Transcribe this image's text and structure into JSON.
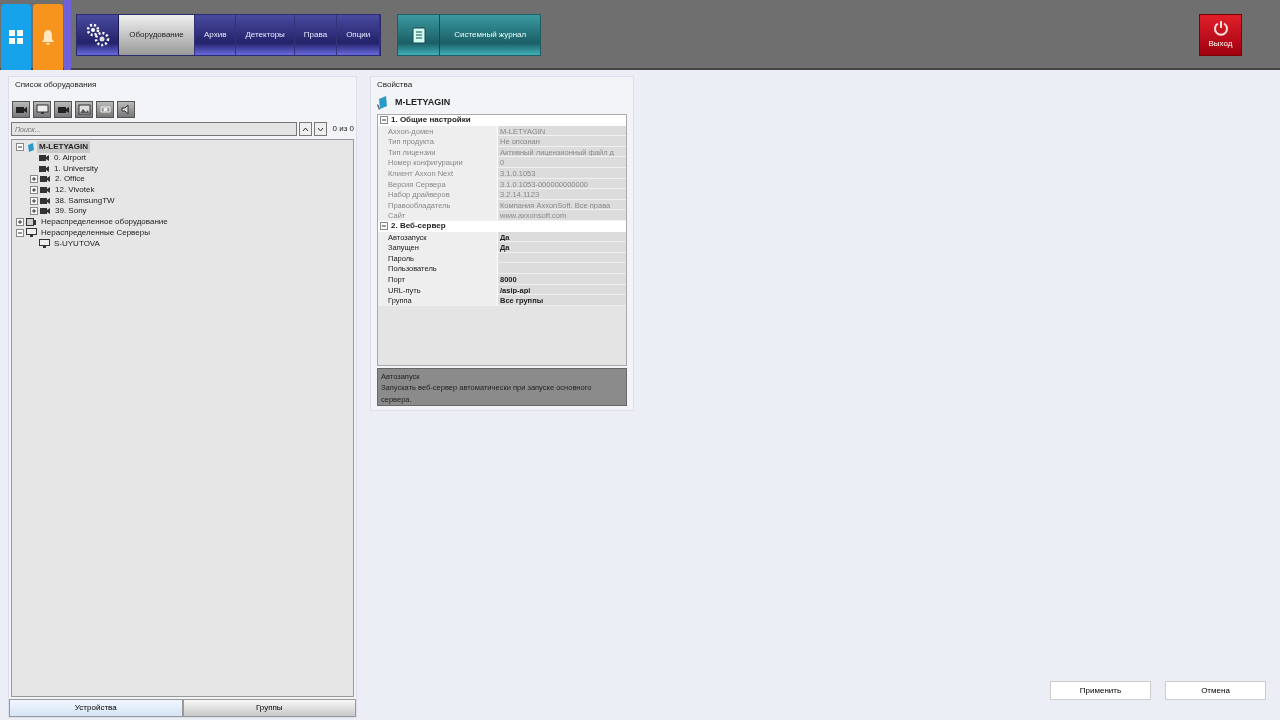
{
  "top_bar": {
    "tabs": [
      {
        "label": "Оборудование",
        "selected": true
      },
      {
        "label": "Архив",
        "selected": false
      },
      {
        "label": "Детекторы",
        "selected": false
      },
      {
        "label": "Права",
        "selected": false
      },
      {
        "label": "Опции",
        "selected": false
      }
    ],
    "journal": {
      "label": "Системный журнал"
    },
    "exit": {
      "label": "Выход"
    }
  },
  "equipment": {
    "title": "Список оборудования",
    "search": {
      "placeholder": "Поиск..."
    },
    "counter": "0 из 0",
    "tree": [
      {
        "label": "M-LETYAGIN",
        "kind": "server",
        "expandable": true,
        "expanded": true,
        "selected": true,
        "children": [
          {
            "label": "0. Airport",
            "kind": "camera",
            "expandable": false,
            "selected": false
          },
          {
            "label": "1. University",
            "kind": "camera",
            "expandable": false,
            "selected": false
          },
          {
            "label": "2. Office",
            "kind": "camera",
            "expandable": true,
            "expanded": false,
            "selected": false
          },
          {
            "label": "12. Vivotek",
            "kind": "camera",
            "expandable": true,
            "expanded": false,
            "selected": false
          },
          {
            "label": "38. SamsungTW",
            "kind": "camera",
            "expandable": true,
            "expanded": false,
            "selected": false
          },
          {
            "label": "39. Sony",
            "kind": "camera",
            "expandable": true,
            "expanded": false,
            "selected": false
          }
        ]
      },
      {
        "label": "Нераспределенное оборудование",
        "kind": "device",
        "expandable": true,
        "expanded": false,
        "selected": false
      },
      {
        "label": "Нераспределенные Серверы",
        "kind": "monitor",
        "expandable": true,
        "expanded": true,
        "selected": false,
        "children": [
          {
            "label": "S-UYUTOVA",
            "kind": "monitor",
            "expandable": false,
            "selected": false
          }
        ]
      }
    ],
    "tabs": [
      {
        "label": "Устройства",
        "selected": true
      },
      {
        "label": "Группы",
        "selected": false
      }
    ]
  },
  "properties": {
    "title": "Свойства",
    "object": "M-LETYAGIN",
    "sections": [
      {
        "title": "1. Общие настройки",
        "expanded": true,
        "readonly": true,
        "rows": [
          {
            "name": "Axxon-домен",
            "value": "M-LETYAGIN"
          },
          {
            "name": "Тип продукта",
            "value": "Не опознан"
          },
          {
            "name": "Тип лицензии",
            "value": "Активный лицензионный файл д"
          },
          {
            "name": "Номер конфигурации",
            "value": "0"
          },
          {
            "name": "Клиент Axxon Next",
            "value": "3.1.0.1053"
          },
          {
            "name": "Версия Сервера",
            "value": "3.1.0.1053-000000000000"
          },
          {
            "name": "Набор драйверов",
            "value": "3.2.14.1123"
          },
          {
            "name": "Правообладатель",
            "value": "Компания AxxonSoft. Все права"
          },
          {
            "name": "Сайт",
            "value": "www.axxonsoft.com"
          }
        ]
      },
      {
        "title": "2. Веб-сервер",
        "expanded": true,
        "readonly": false,
        "rows": [
          {
            "name": "Автозапуск",
            "value": "Да"
          },
          {
            "name": "Запущен",
            "value": "Да"
          },
          {
            "name": "Пароль",
            "value": ""
          },
          {
            "name": "Пользователь",
            "value": ""
          },
          {
            "name": "Порт",
            "value": "8000"
          },
          {
            "name": "URL-путь",
            "value": "/asip-api"
          },
          {
            "name": "Группа",
            "value": "Все группы"
          }
        ]
      }
    ],
    "description": {
      "title": "Автозапуск",
      "text": "Запускать веб-сервер автоматически при запуске основного сервера."
    }
  },
  "buttons": [
    "Применить",
    "Отмена"
  ]
}
